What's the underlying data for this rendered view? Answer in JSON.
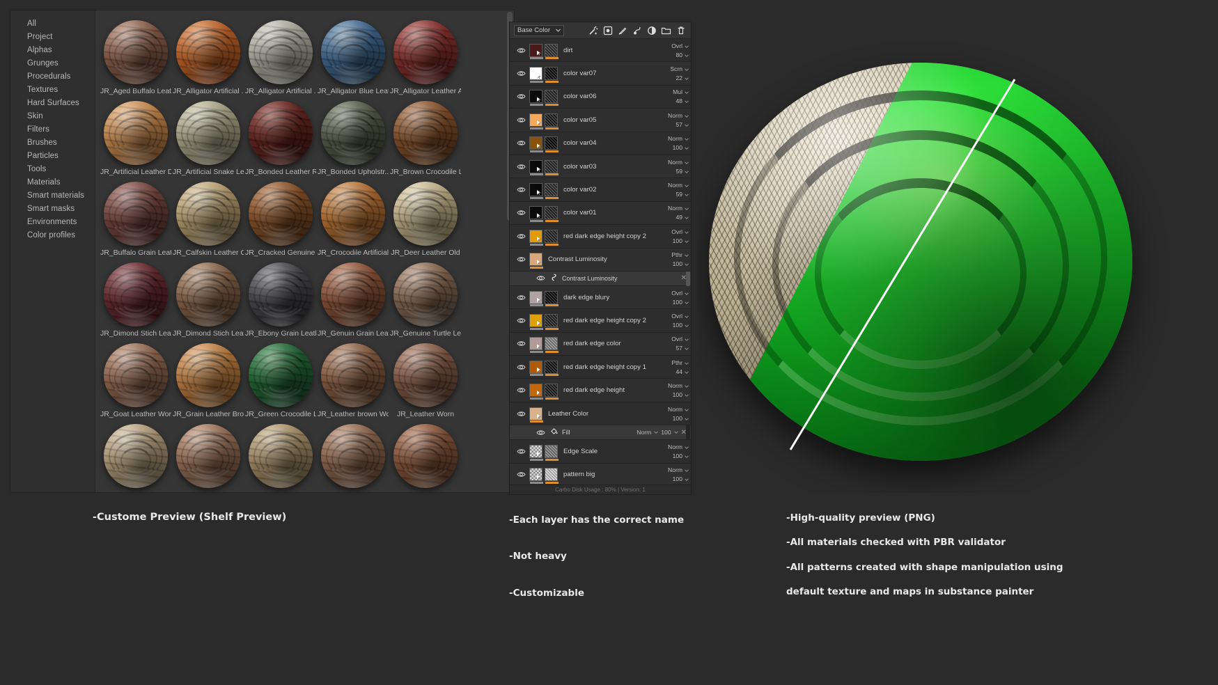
{
  "shelf": {
    "sidebar": {
      "items": [
        {
          "label": "All"
        },
        {
          "label": "Project"
        },
        {
          "label": "Alphas"
        },
        {
          "label": "Grunges"
        },
        {
          "label": "Procedurals"
        },
        {
          "label": "Textures"
        },
        {
          "label": "Hard Surfaces"
        },
        {
          "label": "Skin"
        },
        {
          "label": "Filters"
        },
        {
          "label": "Brushes"
        },
        {
          "label": "Particles"
        },
        {
          "label": "Tools"
        },
        {
          "label": "Materials"
        },
        {
          "label": "Smart materials"
        },
        {
          "label": "Smart masks"
        },
        {
          "label": "Environments"
        },
        {
          "label": "Color profiles"
        }
      ]
    },
    "materials": [
      {
        "label": "JR_Aged Buffalo Leat...",
        "c1": "#b98a74",
        "c2": "#7d5543",
        "c3": "#4a2e22"
      },
      {
        "label": "JR_Alligator Artificial ...",
        "c1": "#e08a4e",
        "c2": "#b05a24",
        "c3": "#6a3010"
      },
      {
        "label": "JR_Alligator Artificial ...",
        "c1": "#cfcdc2",
        "c2": "#a3a195",
        "c3": "#5e5d53"
      },
      {
        "label": "JR_Alligator Blue Leat...",
        "c1": "#6d93b5",
        "c2": "#3a5f84",
        "c3": "#1c3246"
      },
      {
        "label": "JR_Alligator Leather A...",
        "c1": "#b0564f",
        "c2": "#7b2b28",
        "c3": "#431413"
      },
      {
        "label": "JR_Artificial Leather D...",
        "c1": "#e7b27c",
        "c2": "#bb8049",
        "c3": "#6e4420"
      },
      {
        "label": "JR_Artificial Snake Le...",
        "c1": "#cfcbae",
        "c2": "#a09c80",
        "c3": "#5c5944"
      },
      {
        "label": "JR_Bonded Leather Red",
        "c1": "#8f3c34",
        "c2": "#5d211c",
        "c3": "#2f0f0c"
      },
      {
        "label": "JR_Bonded Upholstr...",
        "c1": "#7e8470",
        "c2": "#4e5442",
        "c3": "#262a1e"
      },
      {
        "label": "JR_Brown Crocodile L...",
        "c1": "#b07a52",
        "c2": "#7b4a27",
        "c3": "#432510"
      },
      {
        "label": "JR_Buffalo Grain Leat...",
        "c1": "#a06a62",
        "c2": "#6c3f39",
        "c3": "#3a1f1b"
      },
      {
        "label": "JR_Calfskin Leather Old",
        "c1": "#d9c59b",
        "c2": "#ab9468",
        "c3": "#5f5134"
      },
      {
        "label": "JR_Cracked Genuine ...",
        "c1": "#b5774a",
        "c2": "#7c4a23",
        "c3": "#42250e"
      },
      {
        "label": "JR_Crocodile Artificial...",
        "c1": "#d79a60",
        "c2": "#a9682f",
        "c3": "#5d3513"
      },
      {
        "label": "JR_Deer Leather Old",
        "c1": "#e3d5b1",
        "c2": "#b6a680",
        "c3": "#6a5f43"
      },
      {
        "label": "JR_Dimond Stich Leat...",
        "c1": "#8d4a4e",
        "c2": "#5d2529",
        "c3": "#321013"
      },
      {
        "label": "JR_Dimond Stich Leat...",
        "c1": "#b58f72",
        "c2": "#7d5c43",
        "c3": "#432f20"
      },
      {
        "label": "JR_Ebony Grain Leath...",
        "c1": "#6e6e72",
        "c2": "#404045",
        "c3": "#1d1d21"
      },
      {
        "label": "JR_Genuin Grain Leat...",
        "c1": "#b87a5c",
        "c2": "#7f4b32",
        "c3": "#452618"
      },
      {
        "label": "JR_Genuine Turtle Lea...",
        "c1": "#b49079",
        "c2": "#7c5f49",
        "c3": "#43322430"
      },
      {
        "label": "JR_Goat Leather Worn",
        "c1": "#c09279",
        "c2": "#87604a",
        "c3": "#4a3225"
      },
      {
        "label": "JR_Grain Leather Bro...",
        "c1": "#e2a86f",
        "c2": "#b2763d",
        "c3": "#64401a"
      },
      {
        "label": "JR_Green Crocodile L...",
        "c1": "#3e8e52",
        "c2": "#1f5c31",
        "c3": "#0d3017"
      },
      {
        "label": "JR_Leather brown Worn",
        "c1": "#b8876a",
        "c2": "#7e563c",
        "c3": "#452d1d"
      },
      {
        "label": "JR_Leather Worn",
        "c1": "#b3836c",
        "c2": "#79533f",
        "c3": "#422b20"
      },
      {
        "label": "",
        "c1": "#d6c3a2",
        "c2": "#a79372",
        "c3": "#5e5240"
      },
      {
        "label": "",
        "c1": "#c59a7d",
        "c2": "#8d6750",
        "c3": "#4e3828"
      },
      {
        "label": "",
        "c1": "#ccb68e",
        "c2": "#9a8460",
        "c3": "#564932"
      },
      {
        "label": "",
        "c1": "#bc8f73",
        "c2": "#835f48",
        "c3": "#473226"
      },
      {
        "label": "",
        "c1": "#b5785c",
        "c2": "#7c4e34",
        "c3": "#432a1b"
      }
    ]
  },
  "layers": {
    "channel": {
      "value": "Base Color"
    },
    "toolbar": {
      "icons": [
        {
          "name": "magic-wand-icon"
        },
        {
          "name": "add-fill-layer-icon"
        },
        {
          "name": "add-paint-layer-icon"
        },
        {
          "name": "add-filter-icon"
        },
        {
          "name": "add-generator-icon"
        },
        {
          "name": "add-folder-icon"
        },
        {
          "name": "delete-layer-icon"
        }
      ]
    },
    "footer": "Carbo Disk Usage : 80% | Version: 1",
    "rows": [
      {
        "name": "dirt",
        "blend": "Ovrl",
        "opacity": "80",
        "t1": "#4a1a1a",
        "t2": "#3a3a3a",
        "two": true,
        "bars": "both"
      },
      {
        "name": "color var07",
        "blend": "Scrn",
        "opacity": "22",
        "t1": "#ffffff",
        "t2": "#111111",
        "two": true,
        "bars": "both"
      },
      {
        "name": "color var06",
        "blend": "Mul",
        "opacity": "48",
        "t1": "#0b0b0b",
        "t2": "#2e2e2e",
        "two": true,
        "bars": "both"
      },
      {
        "name": "color var05",
        "blend": "Norm",
        "opacity": "57",
        "t1": "#f5a85c",
        "t2": "#232323",
        "two": true,
        "bars": "both"
      },
      {
        "name": "color var04",
        "blend": "Norm",
        "opacity": "100",
        "t1": "#8a5208",
        "t2": "#0d0d0d",
        "two": true,
        "bars": "both"
      },
      {
        "name": "color var03",
        "blend": "Norm",
        "opacity": "59",
        "t1": "#0a0a0a",
        "t2": "#303030",
        "two": true,
        "bars": "both"
      },
      {
        "name": "color var02",
        "blend": "Norm",
        "opacity": "59",
        "t1": "#0a0a0a",
        "t2": "#343434",
        "two": true,
        "bars": "both"
      },
      {
        "name": "color var01",
        "blend": "Norm",
        "opacity": "49",
        "t1": "#0a0a0a",
        "t2": "#2a2a2a",
        "two": true,
        "bars": "both"
      },
      {
        "name": "red dark edge height copy 2",
        "blend": "Ovrl",
        "opacity": "100",
        "t1": "#e09a07",
        "t2": "#2b2b2b",
        "two": true,
        "bars": "both"
      },
      {
        "name": "Contrast Luminosity",
        "blend": "Pthr",
        "opacity": "100",
        "t1": "#d6a87c",
        "t2": "",
        "two": false,
        "bars": "orange",
        "child": {
          "name": "Contrast Luminosity",
          "icon": "filter-icon"
        }
      },
      {
        "name": "dark edge blury",
        "blend": "Ovrl",
        "opacity": "100",
        "t1": "#b0a2a2",
        "t2": "#101010",
        "two": true,
        "bars": "both"
      },
      {
        "name": "red dark edge height copy 2",
        "blend": "Ovrl",
        "opacity": "100",
        "t1": "#e0a007",
        "t2": "#2b2b2b",
        "two": true,
        "bars": "both"
      },
      {
        "name": "red dark edge color",
        "blend": "Ovrl",
        "opacity": "57",
        "t1": "#b09a98",
        "t2": "#9a9a9a",
        "two": true,
        "bars": "both"
      },
      {
        "name": "red dark edge height copy 1",
        "blend": "Pthr",
        "opacity": "44",
        "t1": "#b05a08",
        "t2": "#1a1a1a",
        "two": true,
        "bars": "both"
      },
      {
        "name": "red dark edge height",
        "blend": "Norm",
        "opacity": "100",
        "t1": "#c4660c",
        "t2": "#242424",
        "two": true,
        "bars": "both"
      },
      {
        "name": "Leather Color",
        "blend": "Norm",
        "opacity": "100",
        "t1": "#d9b18a",
        "t2": "",
        "two": false,
        "bars": "orange",
        "child": {
          "name": "Fill",
          "icon": "fill-icon",
          "blend": "Norm",
          "opacity": "100"
        }
      },
      {
        "name": "Edge Scale",
        "blend": "Norm",
        "opacity": "100",
        "t1": "checker",
        "t2": "#8e8e8e",
        "two": true,
        "bars": "both"
      },
      {
        "name": "pattern big",
        "blend": "Norm",
        "opacity": "100",
        "t1": "checker",
        "t2": "#e8e8e8",
        "two": true,
        "bars": "both"
      }
    ]
  },
  "captions": {
    "left": "-Custome Preview (Shelf Preview)",
    "middle": [
      "-Each layer has the correct name",
      "-Not heavy",
      "-Customizable"
    ],
    "right": [
      "-High-quality preview (PNG)",
      "-All materials checked with PBR validator",
      "-All patterns created with shape manipulation using",
      "default texture and maps in substance painter"
    ]
  },
  "colors": {
    "accent_orange": "#e8741c",
    "panel_bg": "#2c2c2c",
    "shelf_bg": "#353535",
    "green_preview": "#21d62e"
  }
}
